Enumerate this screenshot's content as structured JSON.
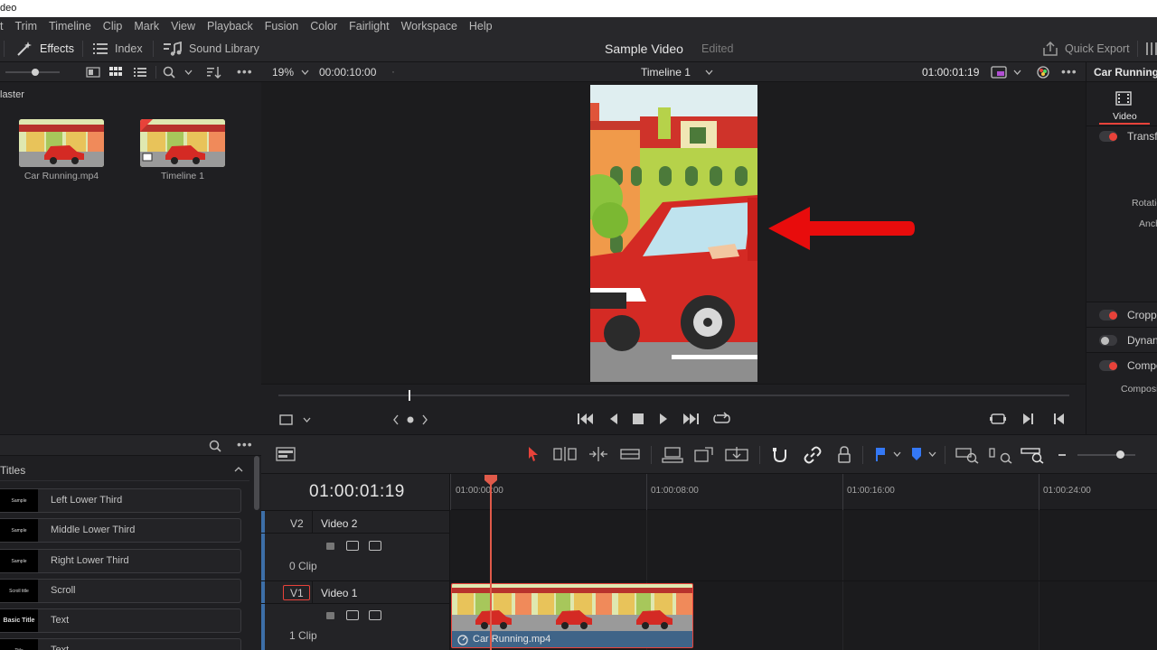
{
  "window": {
    "title": "deo"
  },
  "menu": [
    "t",
    "Trim",
    "Timeline",
    "Clip",
    "Mark",
    "View",
    "Playback",
    "Fusion",
    "Color",
    "Fairlight",
    "Workspace",
    "Help"
  ],
  "toolbar": {
    "effects": "Effects",
    "index": "Index",
    "sound_library": "Sound Library",
    "project_title": "Sample Video",
    "project_status": "Edited",
    "quick_export": "Quick Export"
  },
  "media_pool": {
    "bin": "laster",
    "items": [
      {
        "name": "Car Running.mp4"
      },
      {
        "name": "Timeline 1"
      }
    ]
  },
  "viewer": {
    "zoom": "19%",
    "duration": "00:00:10:00",
    "timeline_name": "Timeline 1",
    "timecode": "01:00:01:19",
    "scrub_position": 0.164
  },
  "inspector": {
    "clip_name": "Car Running",
    "tab": "Video",
    "sections": [
      {
        "label": "Transf",
        "enabled": true
      },
      {
        "label": "Cropp",
        "enabled": true
      },
      {
        "label": "Dynan",
        "enabled": false
      },
      {
        "label": "Compo",
        "enabled": true
      }
    ],
    "fields": {
      "rotation": "Rotatio",
      "anchor": "Anch",
      "composite": "Composi"
    }
  },
  "effects_panel": {
    "category": "Titles",
    "items": [
      {
        "label": "Left Lower Third",
        "thumb": "Sample"
      },
      {
        "label": "Middle Lower Third",
        "thumb": "Sample"
      },
      {
        "label": "Right Lower Third",
        "thumb": "Sample"
      },
      {
        "label": "Scroll",
        "thumb": "Scroll title"
      },
      {
        "label": "Text",
        "thumb": "Basic Title"
      },
      {
        "label": "Text",
        "thumb": "Title"
      }
    ]
  },
  "timeline": {
    "timecode": "01:00:01:19",
    "ruler": [
      "01:00:00:00",
      "01:00:08:00",
      "01:00:16:00",
      "01:00:24:00"
    ],
    "tracks": [
      {
        "id": "V2",
        "name": "Video 2",
        "clips": "0 Clip"
      },
      {
        "id": "V1",
        "name": "Video 1",
        "clips": "1 Clip"
      }
    ],
    "clip_name": "Car Running.mp4"
  },
  "colors": {
    "accent_red": "#e8423a",
    "playhead": "#e05a4a",
    "clip_bar": "#3f6488",
    "flag_blue": "#3478f6"
  }
}
